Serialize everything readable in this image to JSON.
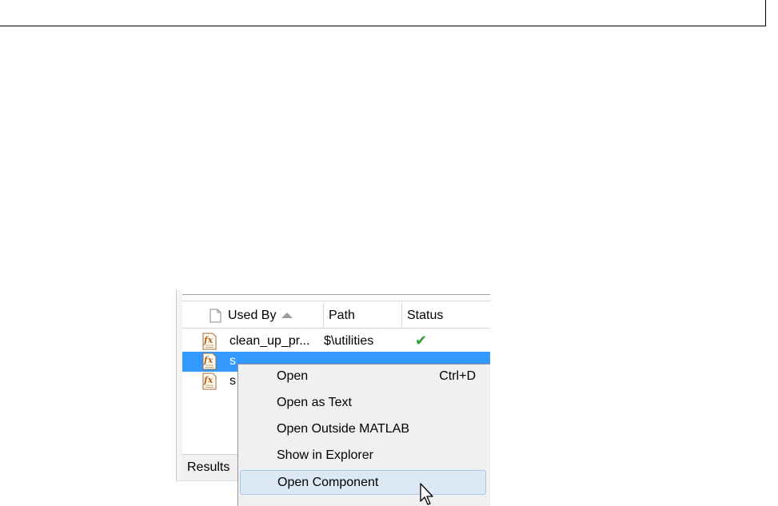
{
  "table": {
    "columns": [
      "Used By",
      "Path",
      "Status"
    ],
    "rows": [
      {
        "used_by": "clean_up_pr...",
        "path": "$\\utilities",
        "status": "✔"
      },
      {
        "used_by": "s",
        "path": "",
        "status": ""
      },
      {
        "used_by": "s",
        "path": "",
        "status": ""
      }
    ]
  },
  "bottom_tab": {
    "label": "Results"
  },
  "context_menu": {
    "items": [
      {
        "label": "Open",
        "shortcut": "Ctrl+D"
      },
      {
        "label": "Open as Text",
        "shortcut": ""
      },
      {
        "label": "Open Outside MATLAB",
        "shortcut": ""
      },
      {
        "label": "Show in Explorer",
        "shortcut": ""
      },
      {
        "label": "Open Component",
        "shortcut": ""
      }
    ],
    "highlighted_item": "Open Component"
  },
  "colors": {
    "selection": "#3399ff",
    "menu_background": "#f0f0f0",
    "menu_hover": "#dde8f5",
    "status_ok": "#2aa02a"
  },
  "icons": [
    "document-icon",
    "sort-ascending-icon",
    "function-file-icon",
    "check-icon",
    "mouse-pointer-icon"
  ]
}
